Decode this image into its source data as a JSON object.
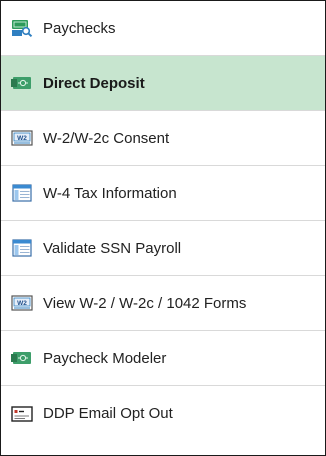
{
  "menu": {
    "items": [
      {
        "label": "Paychecks",
        "icon": "paycheck-search-icon",
        "selected": false
      },
      {
        "label": "Direct Deposit",
        "icon": "money-bill-icon",
        "selected": true
      },
      {
        "label": "W-2/W-2c Consent",
        "icon": "w2-form-icon",
        "selected": false
      },
      {
        "label": "W-4 Tax Information",
        "icon": "form-table-icon",
        "selected": false
      },
      {
        "label": "Validate SSN Payroll",
        "icon": "form-table-icon",
        "selected": false
      },
      {
        "label": "View W-2 / W-2c / 1042 Forms",
        "icon": "w2-form-icon",
        "selected": false
      },
      {
        "label": "Paycheck Modeler",
        "icon": "money-bill-icon",
        "selected": false
      },
      {
        "label": "DDP Email Opt Out",
        "icon": "email-form-icon",
        "selected": false
      }
    ]
  },
  "icons": {
    "w2_text": "W2"
  },
  "colors": {
    "selected_background": "#c7e5cf",
    "accent_green": "#2e9a5b",
    "accent_blue": "#2f7fc1"
  }
}
